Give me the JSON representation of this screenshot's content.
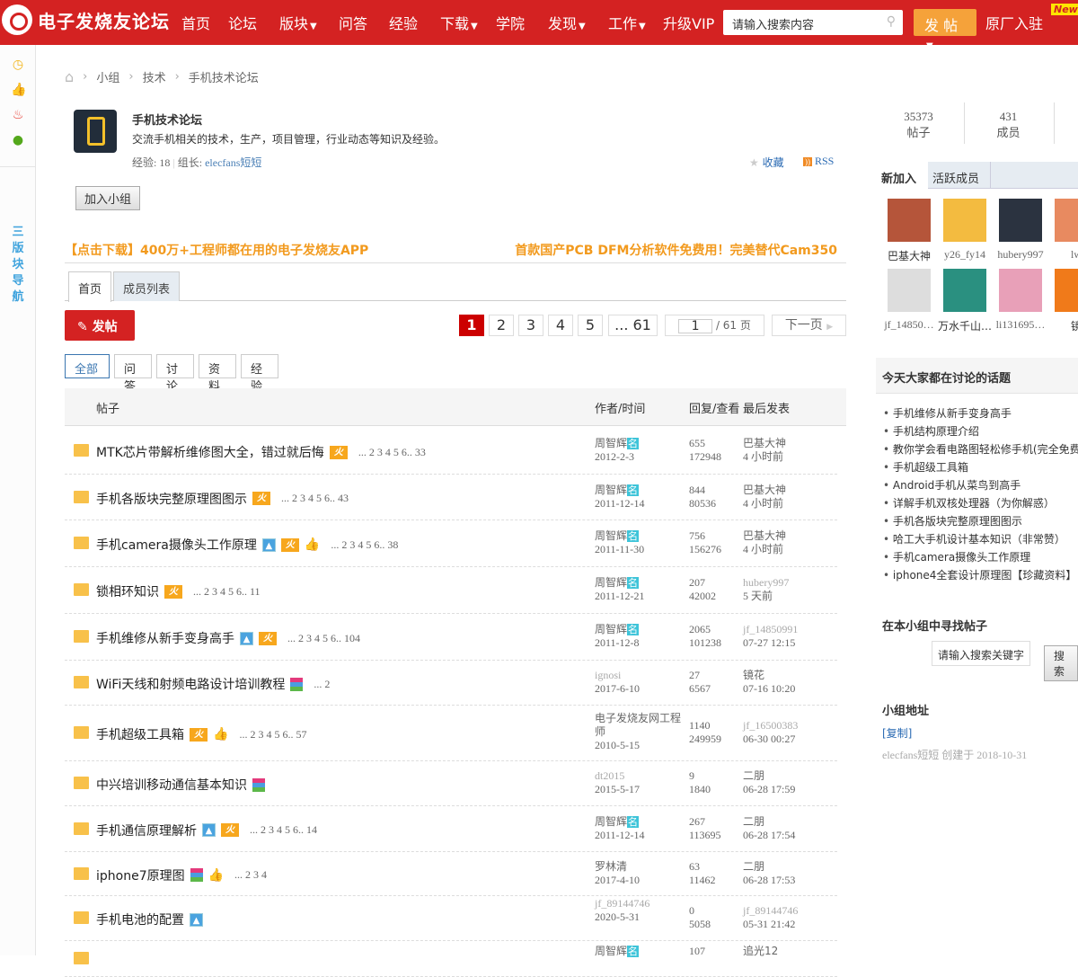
{
  "header": {
    "logo": "电子发烧友论坛",
    "nav": [
      {
        "label": "首页"
      },
      {
        "label": "论坛"
      },
      {
        "label": "版块",
        "dropdown": true
      },
      {
        "label": "问答"
      },
      {
        "label": "经验"
      },
      {
        "label": "下载",
        "dropdown": true
      },
      {
        "label": "学院"
      },
      {
        "label": "发现",
        "dropdown": true
      },
      {
        "label": "工作",
        "dropdown": true
      },
      {
        "label": "升级VIP"
      }
    ],
    "search_placeholder": "请输入搜索内容",
    "post_button": "发 帖",
    "factory": "原厂入驻",
    "new_badge": "New"
  },
  "left_sidebar": {
    "nav_label": [
      "三",
      "版",
      "块",
      "导",
      "航"
    ]
  },
  "breadcrumb": [
    "小组",
    "技术",
    "手机技术论坛"
  ],
  "group": {
    "name": "手机技术论坛",
    "desc": "交流手机相关的技术，生产，项目管理，行业动态等知识及经验。",
    "exp_label": "经验:",
    "exp": "18",
    "leader_label": "组长:",
    "leader": "elecfans短短",
    "favorite": "收藏",
    "rss": "RSS",
    "join": "加入小组"
  },
  "ads": {
    "left": "【点击下载】400万+工程师都在用的电子发烧友APP",
    "right": "首款国产PCB DFM分析软件免费用！完美替代Cam350"
  },
  "tabs": [
    "首页",
    "成员列表"
  ],
  "post_button": "发帖",
  "pagination": {
    "pages": [
      "1",
      "2",
      "3",
      "4",
      "5",
      "... 61"
    ],
    "current": "1",
    "input": "1",
    "total": "/ 61 页",
    "next": "下一页"
  },
  "filters": [
    "全部",
    "问答",
    "讨论",
    "资料",
    "经验"
  ],
  "table": {
    "headers": {
      "title": "帖子",
      "author": "作者/时间",
      "stats": "回复/查看",
      "last": "最后发表"
    },
    "rows": [
      {
        "title": "MTK芯片带解析维修图大全，错过就后悔",
        "tags": [
          "hot"
        ],
        "pages": "... 2 3 4 5 6.. 33",
        "author": "周智辉",
        "ming": "名",
        "date": "2012-2-3",
        "replies": "655",
        "views": "172948",
        "last_user": "巴基大神",
        "last_time": "4 小时前"
      },
      {
        "title": "手机各版块完整原理图图示",
        "tags": [
          "hot"
        ],
        "pages": "... 2 3 4 5 6.. 43",
        "author": "周智辉",
        "ming": "名",
        "date": "2011-12-14",
        "replies": "844",
        "views": "80536",
        "last_user": "巴基大神",
        "last_time": "4 小时前"
      },
      {
        "title": "手机camera摄像头工作原理",
        "tags": [
          "img",
          "hot",
          "thumb"
        ],
        "pages": "... 2 3 4 5 6.. 38",
        "author": "周智辉",
        "ming": "名",
        "date": "2011-11-30",
        "replies": "756",
        "views": "156276",
        "last_user": "巴基大神",
        "last_time": "4 小时前"
      },
      {
        "title": "锁相环知识",
        "tags": [
          "hot"
        ],
        "pages": "... 2 3 4 5 6.. 11",
        "author": "周智辉",
        "ming": "名",
        "date": "2011-12-21",
        "replies": "207",
        "views": "42002",
        "last_user": "hubery997",
        "last_time": "5 天前"
      },
      {
        "title": "手机维修从新手变身高手",
        "tags": [
          "img",
          "hot"
        ],
        "pages": "... 2 3 4 5 6.. 104",
        "author": "周智辉",
        "ming": "名",
        "date": "2011-12-8",
        "replies": "2065",
        "views": "101238",
        "last_user": "jf_14850991",
        "last_time": "07-27 12:15"
      },
      {
        "title": "WiFi天线和射频电路设计培训教程",
        "tags": [
          "rar"
        ],
        "pages": "... 2",
        "author": "ignosi",
        "date": "2017-6-10",
        "replies": "27",
        "views": "6567",
        "last_user": "镜花",
        "last_time": "07-16 10:20"
      },
      {
        "title": "手机超级工具箱",
        "tags": [
          "hot",
          "thumb"
        ],
        "pages": "... 2 3 4 5 6.. 57",
        "author": "电子发烧友网工程师",
        "date": "2010-5-15",
        "replies": "1140",
        "views": "249959",
        "last_user": "jf_16500383",
        "last_time": "06-30 00:27"
      },
      {
        "title": "中兴培训移动通信基本知识",
        "tags": [
          "rar"
        ],
        "pages": "",
        "author": "dt2015",
        "date": "2015-5-17",
        "replies": "9",
        "views": "1840",
        "last_user": "二朋",
        "last_time": "06-28 17:59"
      },
      {
        "title": "手机通信原理解析",
        "tags": [
          "img",
          "hot"
        ],
        "pages": "... 2 3 4 5 6.. 14",
        "author": "周智辉",
        "ming": "名",
        "date": "2011-12-14",
        "replies": "267",
        "views": "113695",
        "last_user": "二朋",
        "last_time": "06-28 17:54"
      },
      {
        "title": "iphone7原理图",
        "tags": [
          "rar",
          "thumb"
        ],
        "pages": "... 2 3 4",
        "author": "罗林清",
        "date": "2017-4-10",
        "replies": "63",
        "views": "11462",
        "last_user": "二朋",
        "last_time": "06-28 17:53"
      },
      {
        "title": "手机电池的配置",
        "tags": [
          "img"
        ],
        "pages": "",
        "author": "jf_89144746",
        "date": "2020-5-31",
        "replies": "0",
        "views": "5058",
        "last_user": "jf_89144746",
        "last_time": "05-31 21:42"
      },
      {
        "title": "",
        "tags": [],
        "pages": "",
        "author": "周智辉",
        "ming": "名",
        "date": "",
        "replies": "107",
        "views": "",
        "last_user": "追光12",
        "last_time": ""
      }
    ]
  },
  "right": {
    "stats": [
      {
        "value": "35373",
        "label": "帖子"
      },
      {
        "value": "431",
        "label": "成员"
      }
    ],
    "member_tabs": [
      "新加入",
      "活跃成员"
    ],
    "members": [
      "巴基大神",
      "y26_fy14",
      "hubery997",
      "lw",
      "jf_14850…",
      "万水千山…",
      "li131695…",
      "镜"
    ],
    "topics_title": "今天大家都在讨论的话题",
    "topics": [
      "手机维修从新手变身高手",
      "手机结构原理介绍",
      "教你学会看电路图轻松修手机(完全免费",
      "手机超级工具箱",
      "Android手机从菜鸟到高手",
      "详解手机双核处理器（为你解惑）",
      "手机各版块完整原理图图示",
      "哈工大手机设计基本知识（非常赞）",
      "手机camera摄像头工作原理",
      "iphone4全套设计原理图【珍藏资料】"
    ],
    "search_title": "在本小组中寻找帖子",
    "search_placeholder": "请输入搜索关键字",
    "search_btn": "搜索",
    "addr_title": "小组地址",
    "copy": "[复制]",
    "created": "elecfans短短 创建于 2018-10-31"
  }
}
